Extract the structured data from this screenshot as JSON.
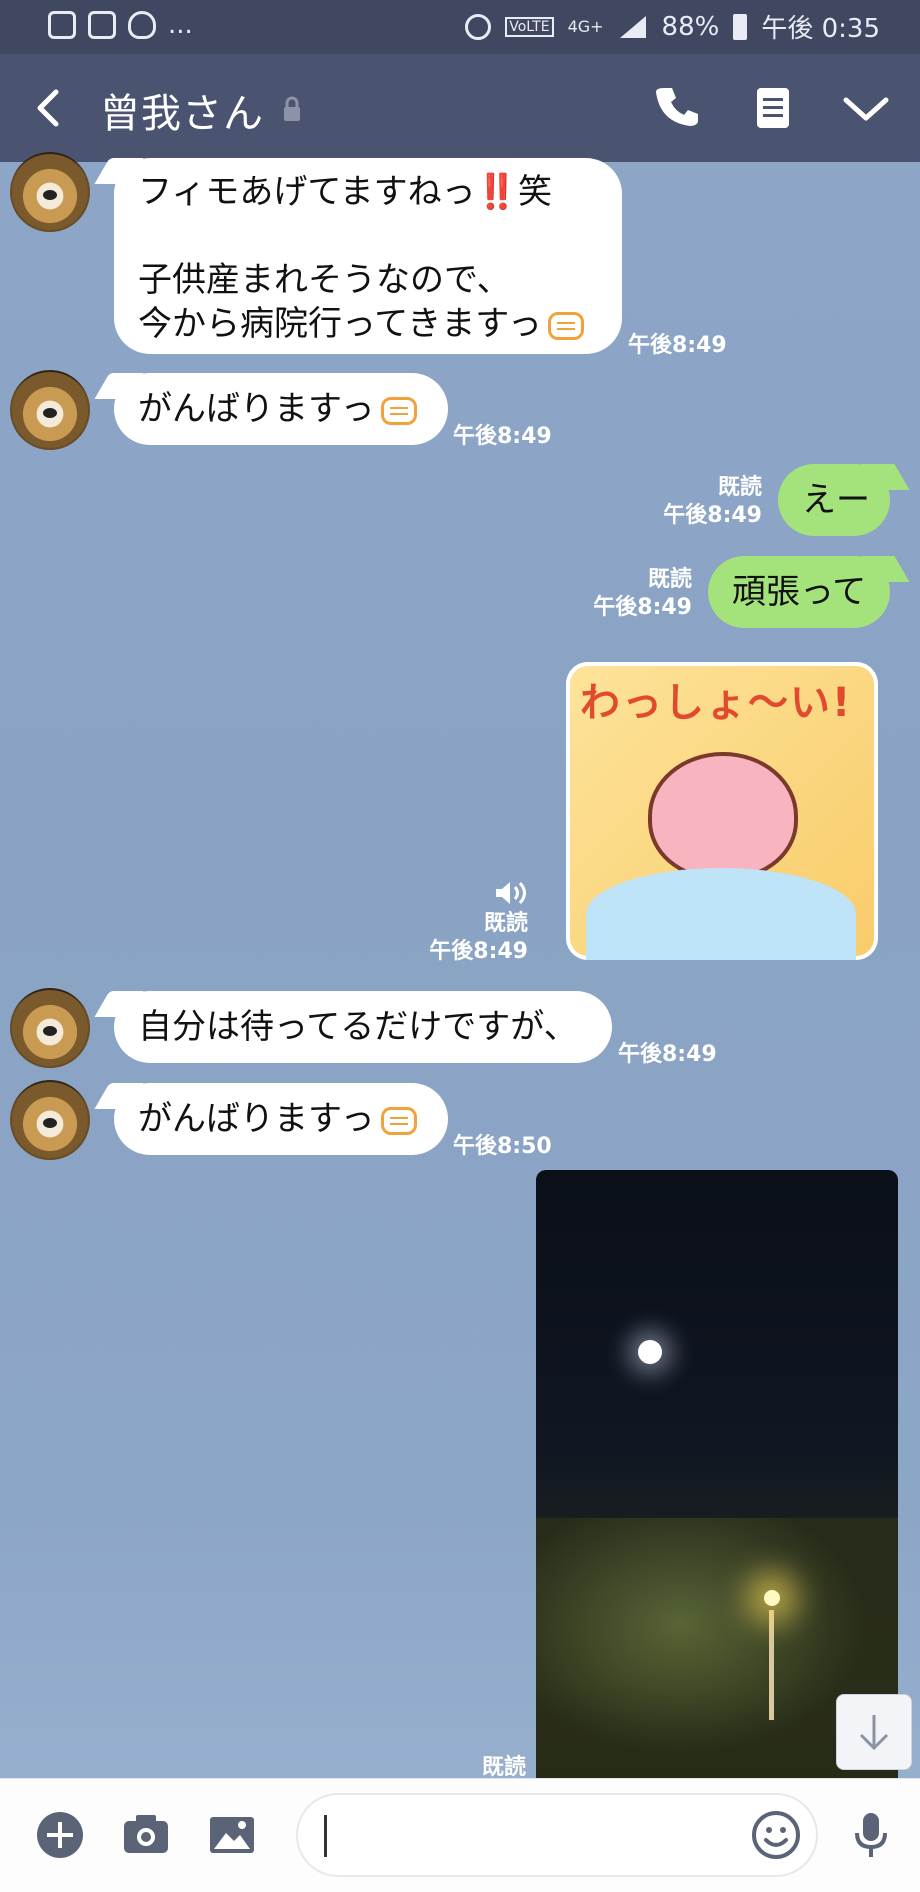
{
  "status_bar": {
    "ellipsis": "...",
    "volte": "VoLTE",
    "network": "4G+",
    "battery": "88%",
    "time": "午後 0:35"
  },
  "header": {
    "title": "曾我さん"
  },
  "messages": [
    {
      "side": "in",
      "text": "フィモあげてますねっ‼️笑\n\n子供産まれそうなので、\n今から病院行ってきますっ",
      "time": "午後8:49"
    },
    {
      "side": "in",
      "text": "がんばりますっ",
      "time": "午後8:49"
    },
    {
      "side": "out",
      "text": "えー",
      "read": "既読",
      "time": "午後8:49"
    },
    {
      "side": "out",
      "text": "頑張って",
      "read": "既読",
      "time": "午後8:49"
    },
    {
      "side": "out",
      "type": "sticker",
      "sticker_text": "わっしょ〜い!",
      "read": "既読",
      "time": "午後8:49"
    },
    {
      "side": "in",
      "text": "自分は待ってるだけですが、",
      "time": "午後8:49"
    },
    {
      "side": "in",
      "text": "がんばりますっ",
      "time": "午後8:50"
    },
    {
      "side": "out",
      "type": "photo",
      "read": "既読"
    }
  ],
  "colors": {
    "header": "#4a5370",
    "status_bar": "#3f4761",
    "out_bubble": "#a4e27b",
    "chat_background": "#8ea6c7"
  }
}
